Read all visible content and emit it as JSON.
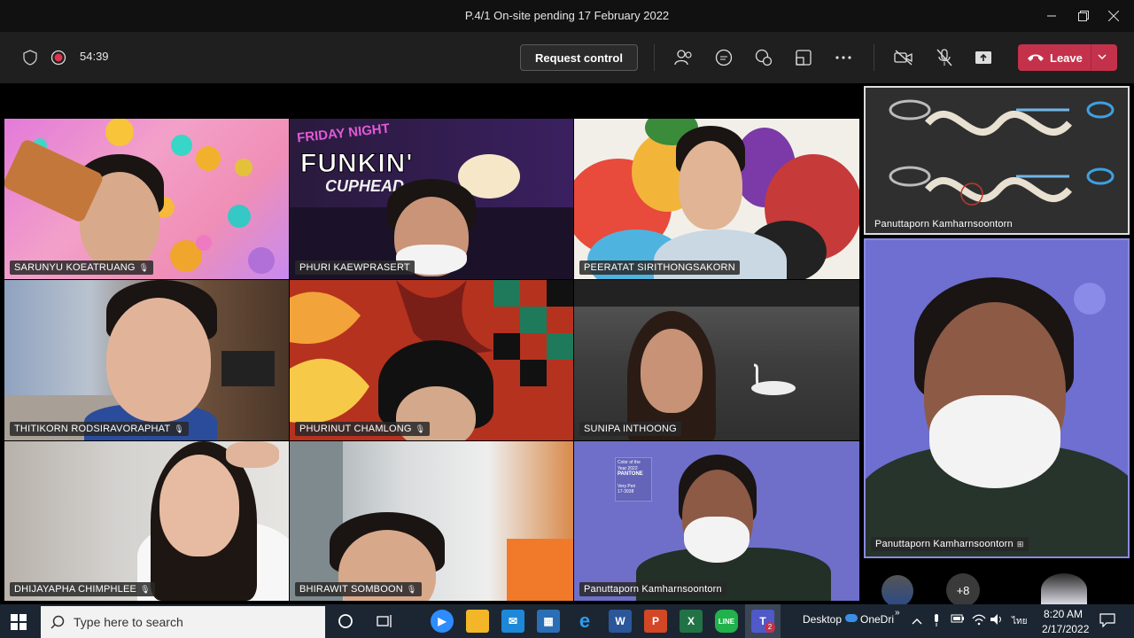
{
  "window": {
    "title": "P.4/1 On-site pending 17 February 2022"
  },
  "toolbar": {
    "timer": "54:39",
    "request_control": "Request control",
    "leave": "Leave"
  },
  "participants": [
    {
      "name": "SARUNYU  KOEATRUANG"
    },
    {
      "name": "PHURI  KAEWPRASERT"
    },
    {
      "name": "PEERATAT  SIRITHONGSAKORN"
    },
    {
      "name": "THITIKORN  RODSIRAVORAPHAT"
    },
    {
      "name": "PHURINUT  CHAMLONG"
    },
    {
      "name": "SUNIPA INTHOONG"
    },
    {
      "name": "DHIJAYAPHA  CHIMPHLEE"
    },
    {
      "name": "BHIRAWIT  SOMBOON"
    },
    {
      "name": "Panuttaporn Kamharnsoontorn"
    }
  ],
  "shared_screen": {
    "presenter": "Panuttaporn Kamharnsoontorn"
  },
  "spotlight": {
    "name": "Panuttaporn Kamharnsoontorn"
  },
  "overflow": {
    "count": "+8"
  },
  "game_banner": {
    "line1": "FRIDAY NIGHT",
    "line2": "FUNKIN'",
    "line3": "CUPHEAD"
  },
  "pantone_card": {
    "l1": "Color of the Year 2022",
    "l2": "PANTONE",
    "l3": "Very Peri",
    "l4": "17-3938"
  },
  "taskbar": {
    "search_placeholder": "Type here to search",
    "desktop": "Desktop",
    "onedrive": "OneDri",
    "time": "8:20 AM",
    "date": "2/17/2022",
    "lang": "ไทย",
    "teams_badge": "2"
  }
}
